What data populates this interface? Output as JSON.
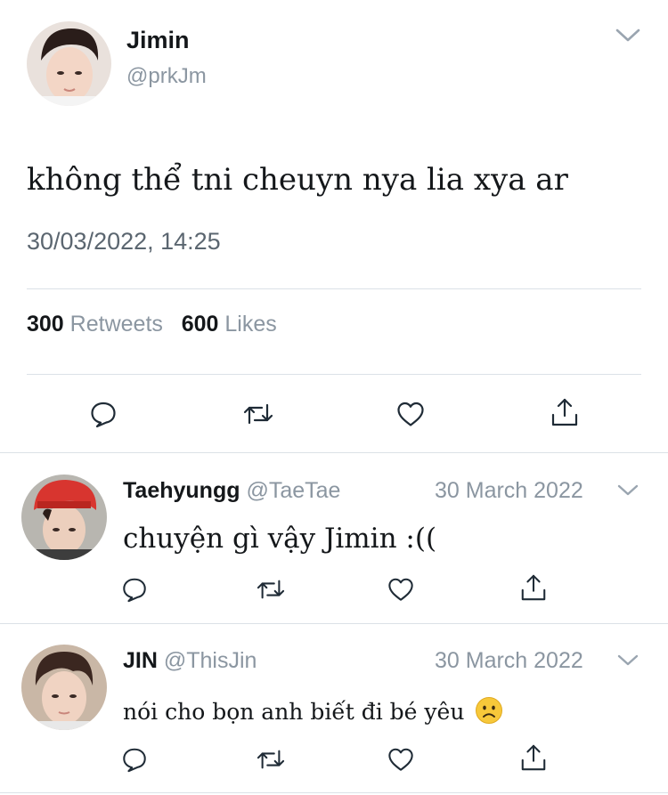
{
  "main_tweet": {
    "name": "Jimin",
    "handle": "@prkJm",
    "text": "không thể tni cheuyn nya lia xya ar",
    "timestamp": "30/03/2022, 14:25",
    "retweets_count": "300",
    "retweets_label": "Retweets",
    "likes_count": "600",
    "likes_label": "Likes"
  },
  "replies": [
    {
      "name": "Taehyungg",
      "handle": "@TaeTae",
      "date": "30 March 2022",
      "text": "chuyện gì vậy Jimin :(("
    },
    {
      "name": "JIN",
      "handle": "@ThisJin",
      "date": "30 March 2022",
      "text": "nói cho bọn anh biết đi bé yêu",
      "emoji": "frowning-face"
    }
  ],
  "icons": {
    "reply": "comment-icon",
    "retweet": "retweet-icon",
    "like": "heart-icon",
    "share": "share-icon",
    "menu": "chevron-down-icon"
  },
  "colors": {
    "icon": "#1f2b36",
    "muted": "#8b96a1",
    "divider": "#dbe1e7"
  }
}
